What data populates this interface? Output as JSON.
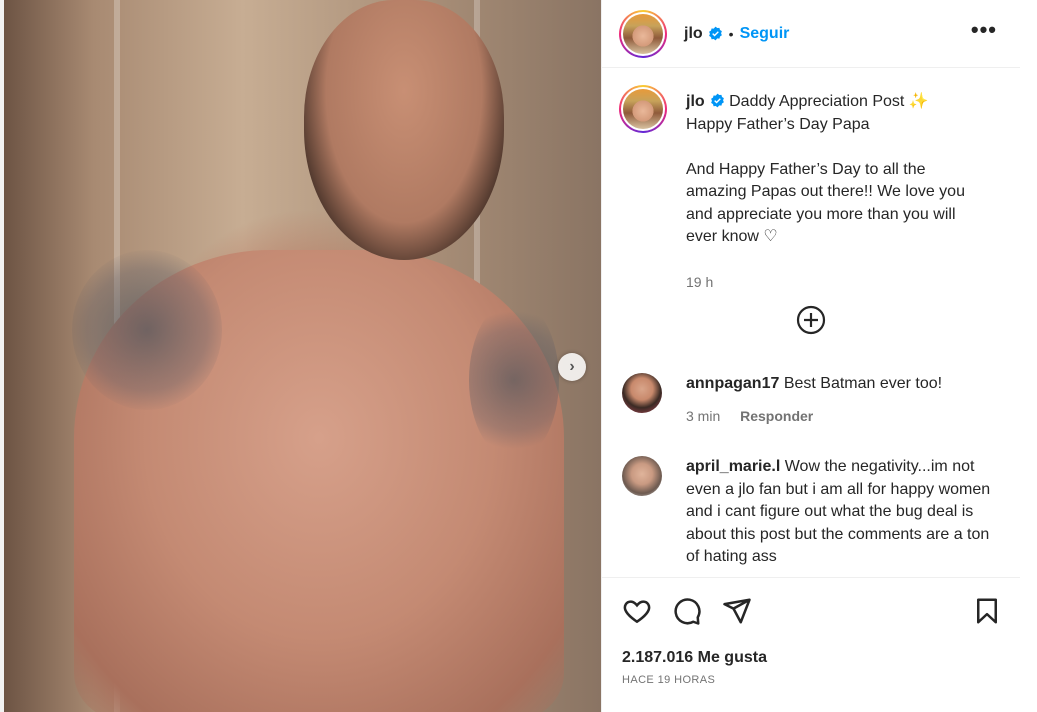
{
  "post": {
    "username": "jlo",
    "follow_label": "Seguir",
    "dot": "•",
    "more_label": "•••",
    "image_alt": "post photo",
    "next_label": "›"
  },
  "caption": {
    "username": "jlo",
    "line1": "Daddy Appreciation Post ✨",
    "line2": "Happy Father’s Day Papa",
    "line3": "And Happy Father’s Day to all the amazing Papas out there!! We love you and appreciate you more than you will ever know ♡",
    "time": "19 h"
  },
  "comments": [
    {
      "username": "annpagan17",
      "text": "Best Batman ever too!",
      "time": "3 min",
      "reply_label": "Responder"
    },
    {
      "username": "april_marie.l",
      "text": "Wow the negativity...im not even a jlo fan but i am all for happy women and i cant figure out what the bug deal is about this post but the comments are a ton of hating ass"
    }
  ],
  "footer": {
    "likes": "2.187.016 Me gusta",
    "ago": "HACE 19 HORAS"
  },
  "colors": {
    "accent": "#0095f6",
    "text": "#262626",
    "muted": "#737373",
    "border": "#efefef"
  }
}
